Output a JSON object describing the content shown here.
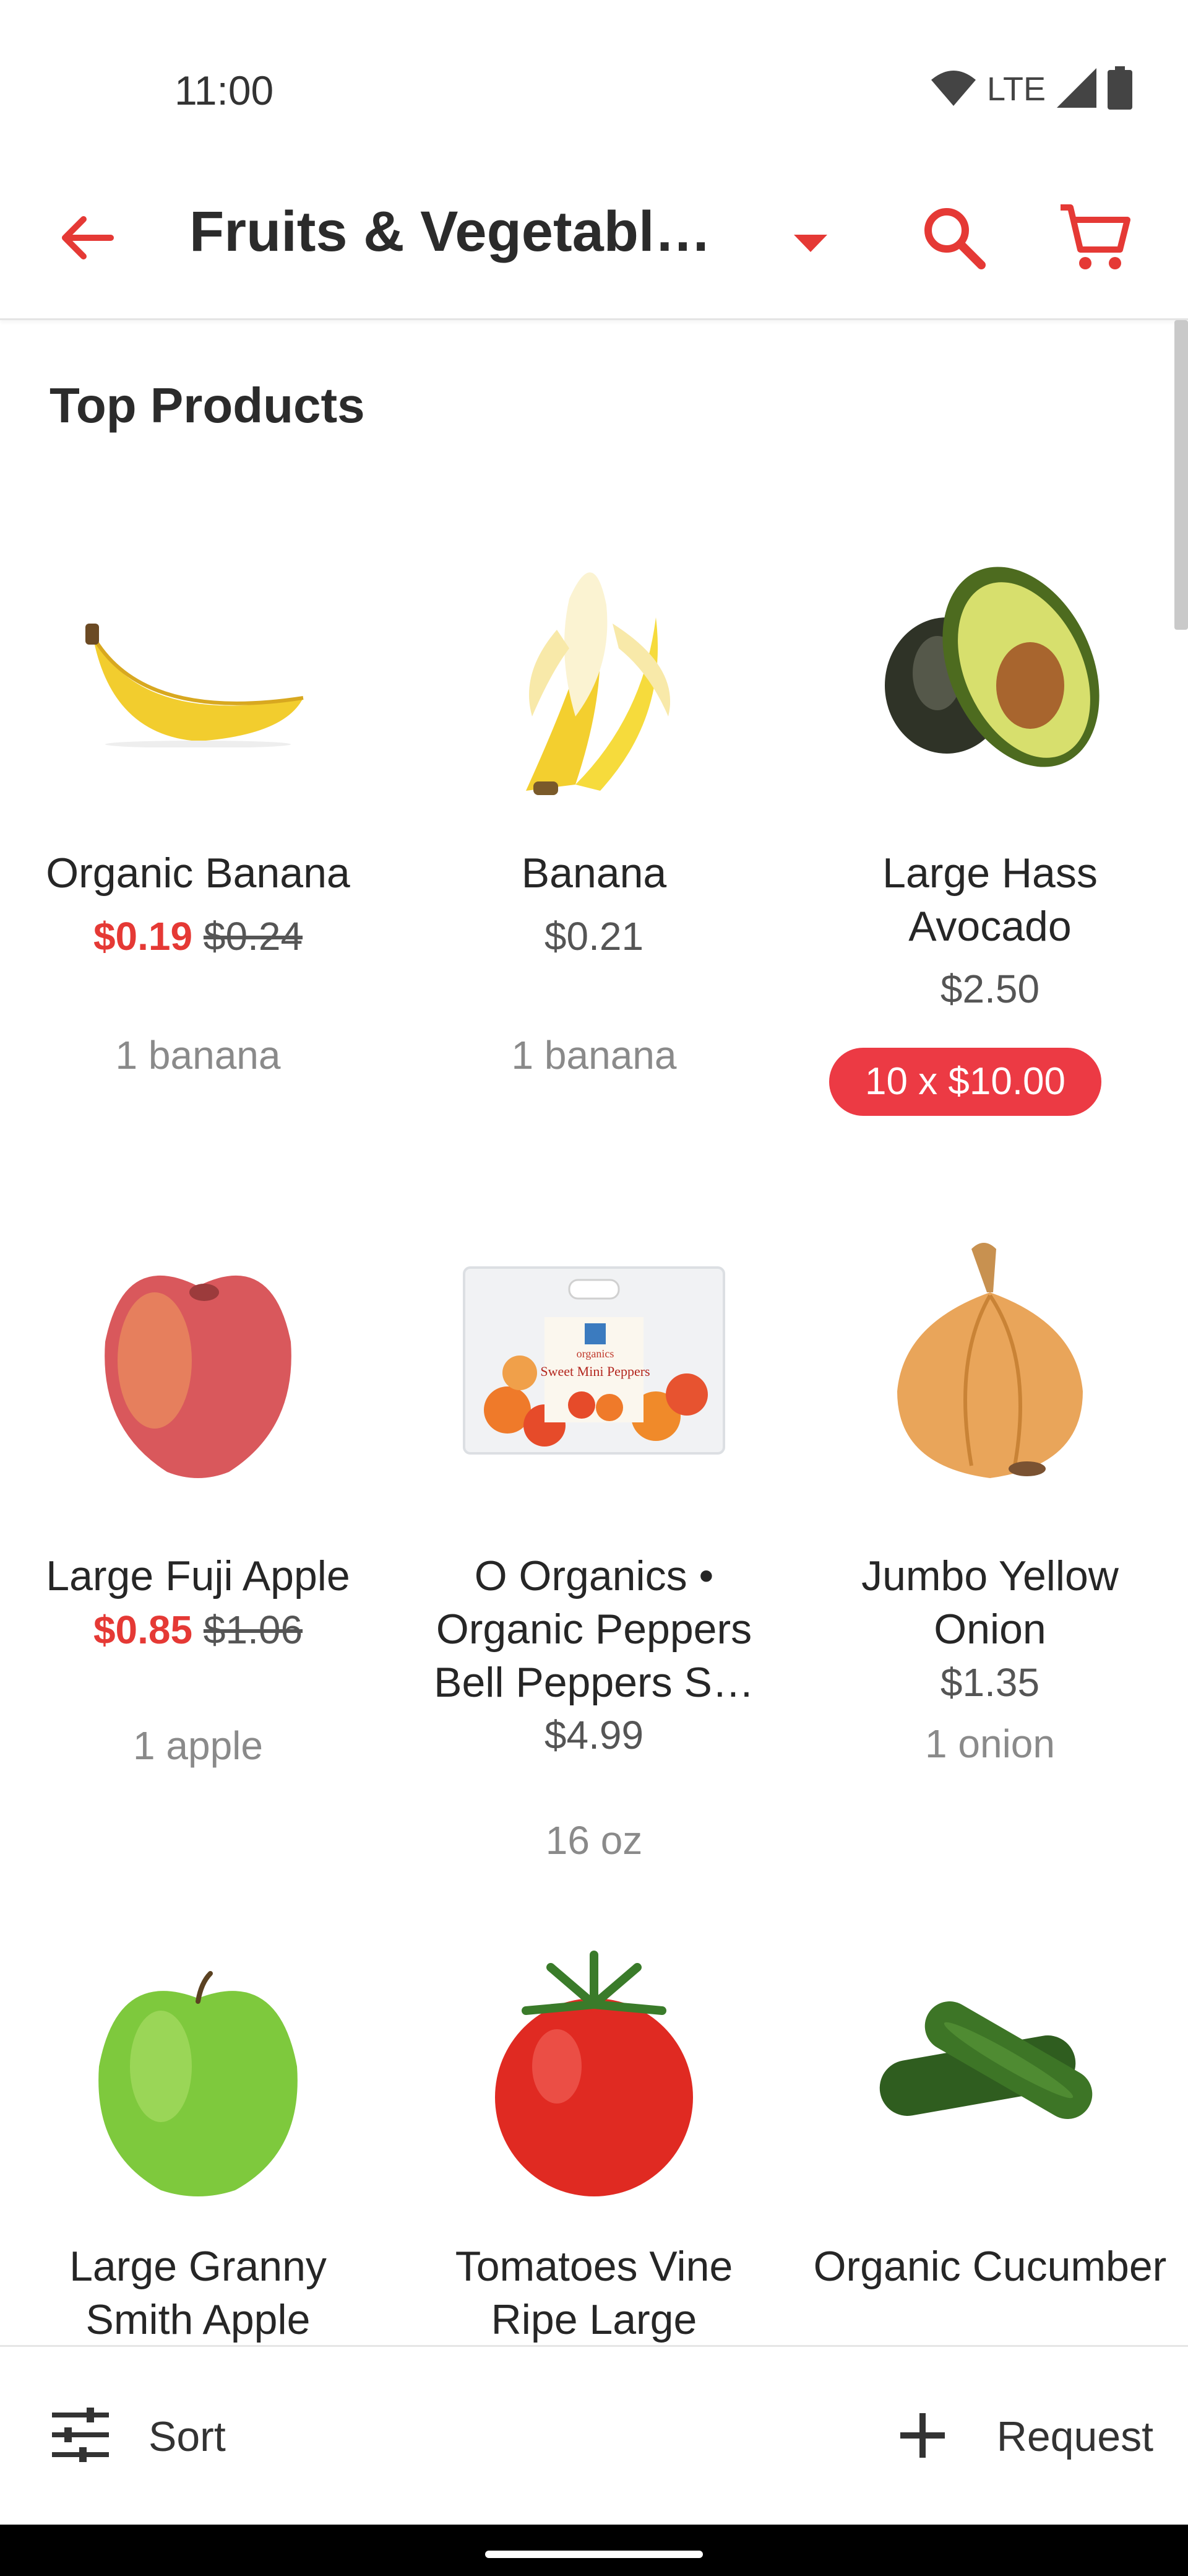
{
  "status_bar": {
    "time": "11:00",
    "network": "LTE",
    "icons": [
      "wifi-icon",
      "signal-icon",
      "battery-icon"
    ]
  },
  "app_bar": {
    "title": "Fruits & Vegetabl…",
    "icons": [
      "back-arrow-icon",
      "dropdown-caret-icon",
      "search-icon",
      "cart-icon"
    ],
    "accent_color": "#e53935"
  },
  "section": {
    "title": "Top Products"
  },
  "products": [
    {
      "name": "Organic Banana",
      "sale_price": "$0.19",
      "original_price": "$0.24",
      "price": "",
      "unit": "1 banana",
      "badge": ""
    },
    {
      "name": "Banana",
      "sale_price": "",
      "original_price": "",
      "price": "$0.21",
      "unit": "1 banana",
      "badge": ""
    },
    {
      "name": "Large Hass Avocado",
      "sale_price": "",
      "original_price": "",
      "price": "$2.50",
      "unit": "",
      "badge": "10 x $10.00"
    },
    {
      "name": "Large Fuji Apple",
      "sale_price": "$0.85",
      "original_price": "$1.06",
      "price": "",
      "unit": "1 apple",
      "badge": ""
    },
    {
      "name": "O Organics • Organic Peppers Bell Peppers S…",
      "sale_price": "",
      "original_price": "",
      "price": "$4.99",
      "unit": "16 oz",
      "badge": ""
    },
    {
      "name": "Jumbo Yellow Onion",
      "sale_price": "",
      "original_price": "",
      "price": "$1.35",
      "unit": "1 onion",
      "badge": ""
    },
    {
      "name": "Large Granny Smith Apple",
      "sale_price": "",
      "original_price": "",
      "price": "",
      "unit": "",
      "badge": ""
    },
    {
      "name": "Tomatoes Vine Ripe Large",
      "sale_price": "",
      "original_price": "",
      "price": "",
      "unit": "",
      "badge": ""
    },
    {
      "name": "Organic Cucumber",
      "sale_price": "",
      "original_price": "",
      "price": "",
      "unit": "",
      "badge": ""
    }
  ],
  "package_label": {
    "brand": "organics",
    "product": "Sweet Mini Peppers"
  },
  "bottom_bar": {
    "sort_label": "Sort",
    "request_label": "Request",
    "icons": [
      "sliders-icon",
      "plus-icon"
    ]
  }
}
